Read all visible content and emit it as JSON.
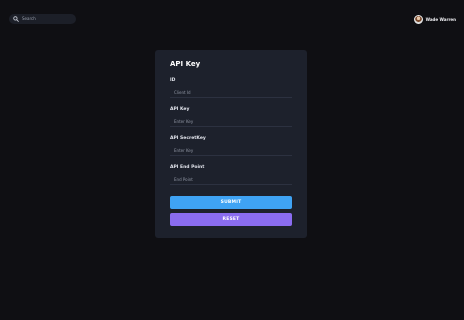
{
  "header": {
    "search_placeholder": "Search",
    "user_name": "Wade Warren"
  },
  "form": {
    "title": "API Key",
    "fields": [
      {
        "label": "ID",
        "placeholder": "Client Id"
      },
      {
        "label": "API Key",
        "placeholder": "Enter Key"
      },
      {
        "label": "API SecretKey",
        "placeholder": "Enter Key"
      },
      {
        "label": "API End Point",
        "placeholder": "End Point"
      }
    ],
    "submit_label": "SUBMIT",
    "reset_label": "RESET"
  },
  "colors": {
    "background": "#0f0f13",
    "card": "#1d212c",
    "submit": "#3fa3f4",
    "reset": "#8a6cf0"
  },
  "icons": {
    "search": "search-icon",
    "avatar": "avatar"
  }
}
